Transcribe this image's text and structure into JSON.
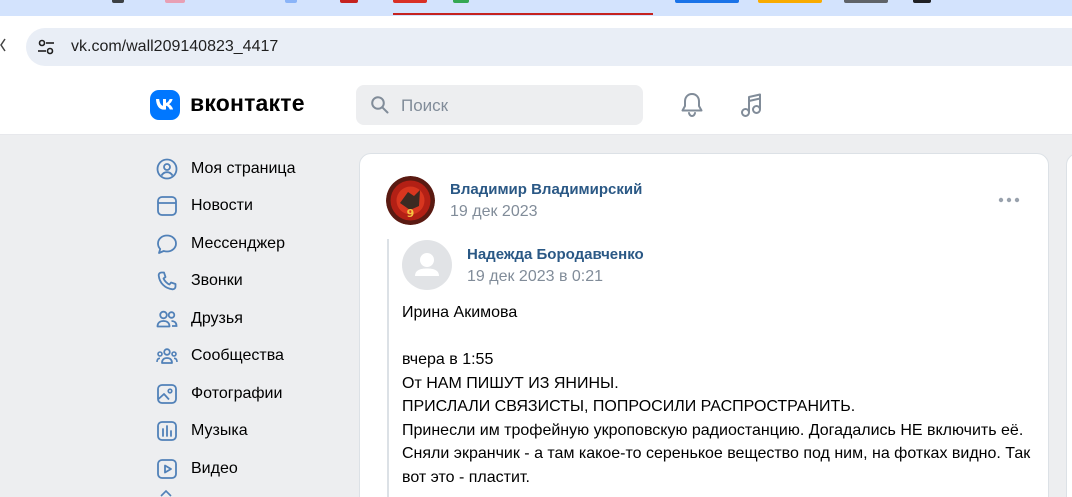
{
  "browser": {
    "url": "vk.com/wall209140823_4417",
    "tab_colors": [
      "#3c4043",
      "#e8a0b4",
      "#8ab4f8",
      "#d93025",
      "#34a853",
      "#1a73e8",
      "#f9ab00",
      "#5f6368"
    ]
  },
  "header": {
    "logo_text": "вконтакте",
    "search_placeholder": "Поиск",
    "brand_color": "#0077ff"
  },
  "menu": [
    {
      "label": "Моя страница",
      "icon": "user-circle-icon"
    },
    {
      "label": "Новости",
      "icon": "newspaper-icon"
    },
    {
      "label": "Мессенджер",
      "icon": "message-bubble-icon"
    },
    {
      "label": "Звонки",
      "icon": "phone-icon"
    },
    {
      "label": "Друзья",
      "icon": "users-icon"
    },
    {
      "label": "Сообщества",
      "icon": "communities-icon"
    },
    {
      "label": "Фотографии",
      "icon": "photo-icon"
    },
    {
      "label": "Музыка",
      "icon": "music-bars-icon"
    },
    {
      "label": "Видео",
      "icon": "video-play-icon"
    }
  ],
  "post": {
    "author": "Владимир Владимирский",
    "date": "19 дек 2023",
    "repost": {
      "author": "Надежда Бородавченко",
      "date": "19 дек 2023 в 0:21"
    },
    "text_lines": [
      "Ирина Акимова",
      "",
      "вчера в 1:55",
      "От НАМ ПИШУТ ИЗ ЯНИНЫ.",
      "ПРИСЛАЛИ СВЯЗИСТЫ, ПОПРОСИЛИ РАСПРОСТРАНИТЬ.",
      "Принесли им трофейную укроповскую радиостанцию. Догадались НЕ включить её. Сняли экранчик - а там какое-то серенькое вещество под ним, на фотках видно. Так вот это - пластит."
    ]
  }
}
